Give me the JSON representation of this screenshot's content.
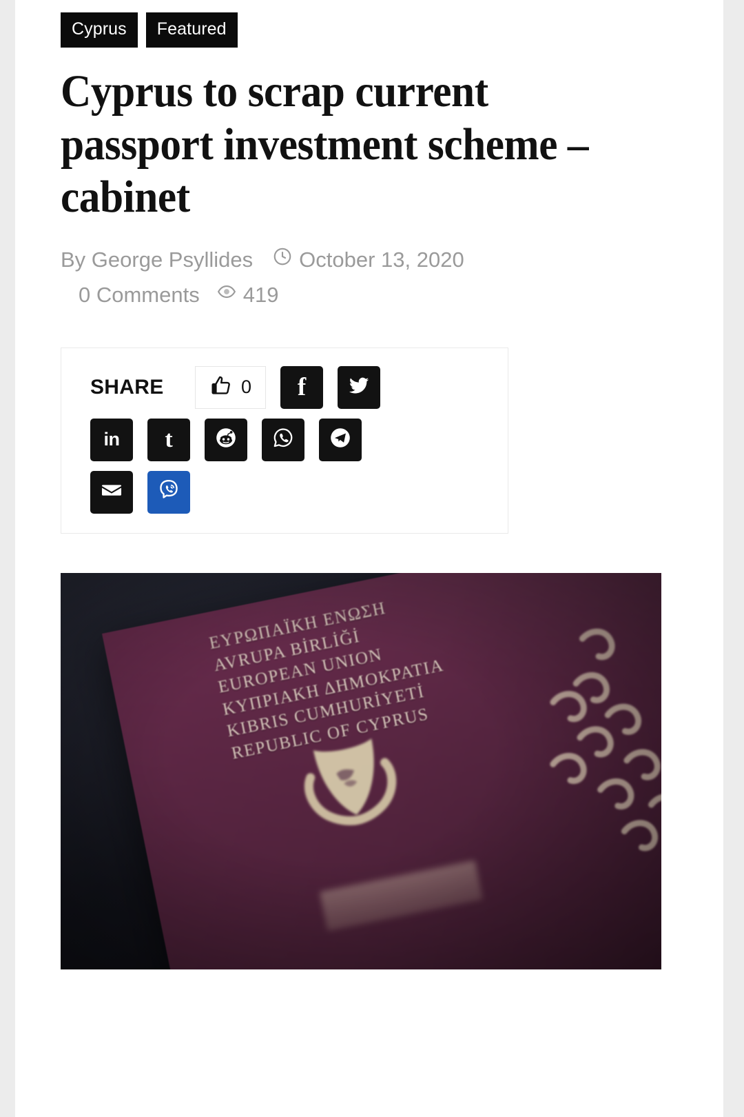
{
  "article": {
    "categories": [
      {
        "label": "Cyprus"
      },
      {
        "label": "Featured"
      }
    ],
    "headline": "Cyprus to scrap current passport investment scheme – cabinet",
    "byline": {
      "author": "By George Psyllides",
      "date": "October 13, 2020",
      "comments": "0 Comments",
      "views": "419",
      "clock_icon": "clock-icon",
      "eye_icon": "eye-icon"
    }
  },
  "share": {
    "label": "SHARE",
    "like": {
      "icon": "thumbs-up-icon",
      "count": "0"
    },
    "buttons": [
      {
        "name": "facebook",
        "glyph": "f",
        "color": "#121212"
      },
      {
        "name": "twitter",
        "glyph": "twitter-bird-icon",
        "color": "#121212"
      },
      {
        "name": "linkedin",
        "glyph": "in",
        "color": "#121212"
      },
      {
        "name": "tumblr",
        "glyph": "t",
        "color": "#121212"
      },
      {
        "name": "reddit",
        "glyph": "reddit-alien-icon",
        "color": "#121212"
      },
      {
        "name": "whatsapp",
        "glyph": "whatsapp-icon",
        "color": "#121212"
      },
      {
        "name": "telegram",
        "glyph": "telegram-icon",
        "color": "#121212"
      },
      {
        "name": "email",
        "glyph": "envelope-icon",
        "color": "#121212"
      },
      {
        "name": "viber",
        "glyph": "viber-icon",
        "color": "#1d5bb8"
      }
    ]
  },
  "featured_image": {
    "alt": "Cyprus passport on a dark surface",
    "passport_lines": [
      "ΕΥΡΩΠΑΪΚΗ ΕΝΩΣΗ",
      "AVRUPA BİRLİĞİ",
      "EUROPEAN UNION",
      "ΚΥΠΡΙΑΚΗ ΔΗΜΟΚΡΑΤΙΑ",
      "KIBRIS CUMHURİYETİ",
      "REPUBLIC OF CYPRUS"
    ],
    "cover_color": "#5d2845",
    "emblem": "cyprus-coat-of-arms"
  }
}
